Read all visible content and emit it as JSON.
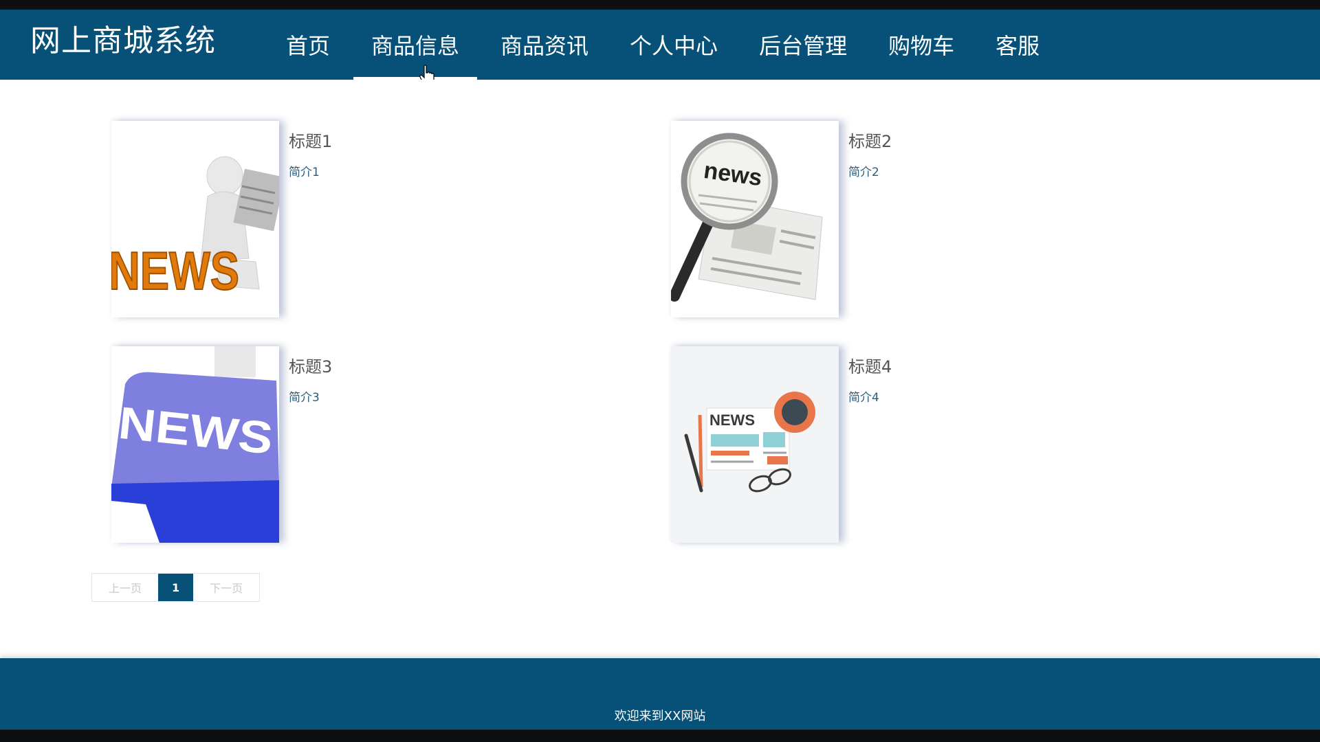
{
  "brand": "网上商城系统",
  "nav": [
    {
      "label": "首页",
      "active": false
    },
    {
      "label": "商品信息",
      "active": true
    },
    {
      "label": "商品资讯",
      "active": false
    },
    {
      "label": "个人中心",
      "active": false
    },
    {
      "label": "后台管理",
      "active": false
    },
    {
      "label": "购物车",
      "active": false
    },
    {
      "label": "客服",
      "active": false
    }
  ],
  "news": [
    {
      "title": "标题1",
      "desc": "简介1",
      "image": "news-3d-figure-icon"
    },
    {
      "title": "标题2",
      "desc": "简介2",
      "image": "magnifier-newspaper-icon"
    },
    {
      "title": "标题3",
      "desc": "简介3",
      "image": "news-keyboard-key-icon"
    },
    {
      "title": "标题4",
      "desc": "简介4",
      "image": "newspaper-coffee-glasses-icon"
    }
  ],
  "pager": {
    "prev": "上一页",
    "current": "1",
    "next": "下一页"
  },
  "footer": {
    "text": "欢迎来到XX网站"
  },
  "colors": {
    "primary": "#075178",
    "background": "#ffffff"
  }
}
